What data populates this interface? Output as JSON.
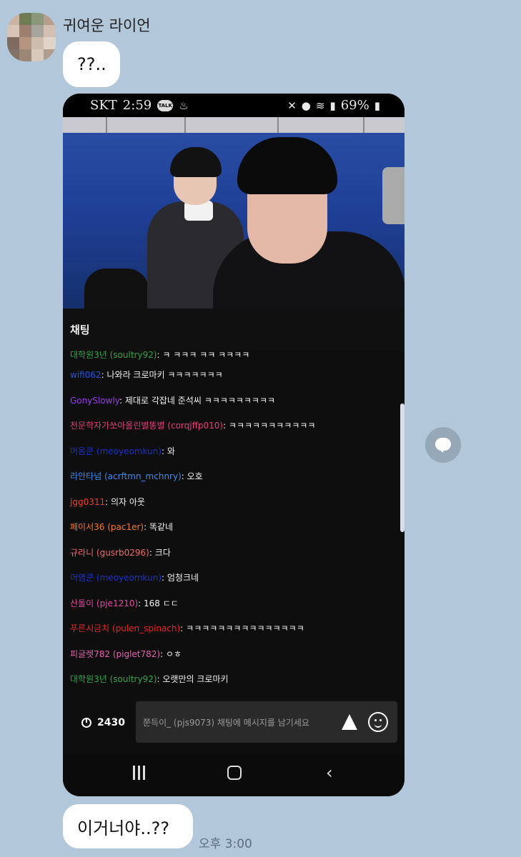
{
  "chat_room": {
    "sender": "귀여운 라이언",
    "message1": "??..",
    "message2": "이거너야..??",
    "time": "오후 3:00"
  },
  "phone": {
    "status": {
      "carrier": "SKT",
      "clock": "2:59",
      "talk_badge": "TALK",
      "battery": "69%"
    },
    "chat_title": "채팅",
    "chat_messages": [
      {
        "nick": "대학원3년 (soultry92)",
        "text": ": ㅋ ㅋㅋㅋ ㅋㅋ ㅋㅋㅋㅋ",
        "color": "#2fa84a"
      },
      {
        "nick": "wifi062",
        "text": ": 나와라 크로마키 ㅋㅋㅋㅋㅋㅋㅋ",
        "color": "#1f55e8"
      },
      {
        "nick": "GonySlowly",
        "text": ": 제대로 각잡네 준석씨 ㅋㅋㅋㅋㅋㅋㅋㅋㅋ",
        "color": "#9b3bef"
      },
      {
        "nick": "천문학자가쏘아올린별똥별 (corqjffp010)",
        "text": ": ㅋㅋㅋㅋㅋㅋㅋㅋㅋㅋㅋ",
        "color": "#e33e7a"
      },
      {
        "nick": "머옴쿤 (meoyeomkun)",
        "text": ": 와",
        "color": "#1d31c9"
      },
      {
        "nick": "라안타넘 (acrftmn_mchnry)",
        "text": ": 오호",
        "color": "#3b8bf1"
      },
      {
        "nick": "jgg0311",
        "text": ": 의자 아웃",
        "color": "#f0401f"
      },
      {
        "nick": "페이서36 (pac1er)",
        "text": ": 똑같네",
        "color": "#f27a2a"
      },
      {
        "nick": "규라니 (gusrb0296)",
        "text": ": 크다",
        "color": "#ef6b6b"
      },
      {
        "nick": "머염쿤 (meoyeomkun)",
        "text": ": 엄청크네",
        "color": "#1d31c9"
      },
      {
        "nick": "산돌이 (pje1210)",
        "text": ": 168 ㄷㄷ",
        "color": "#e24aa0"
      },
      {
        "nick": "푸른시금치 (pulen_spinach)",
        "text": ": ㅋㅋㅋㅋㅋㅋㅋㅋㅋㅋㅋㅋㅋㅋㅋ",
        "color": "#f0201d"
      },
      {
        "nick": "피글렛782 (piglet782)",
        "text": ": ㅇㅎ",
        "color": "#ec5fb0"
      },
      {
        "nick": "대학원3년 (soultry92)",
        "text": ": 오랫만의 크로마키",
        "color": "#2fa84a"
      }
    ],
    "viewer_count": "2430",
    "input_placeholder": "쭌득이_ (pjs9073) 채팅에 메시지를 남기세요"
  },
  "icons": {
    "send": "send-icon",
    "emoji": "emoji-icon",
    "share": "speech-bubble-icon"
  }
}
